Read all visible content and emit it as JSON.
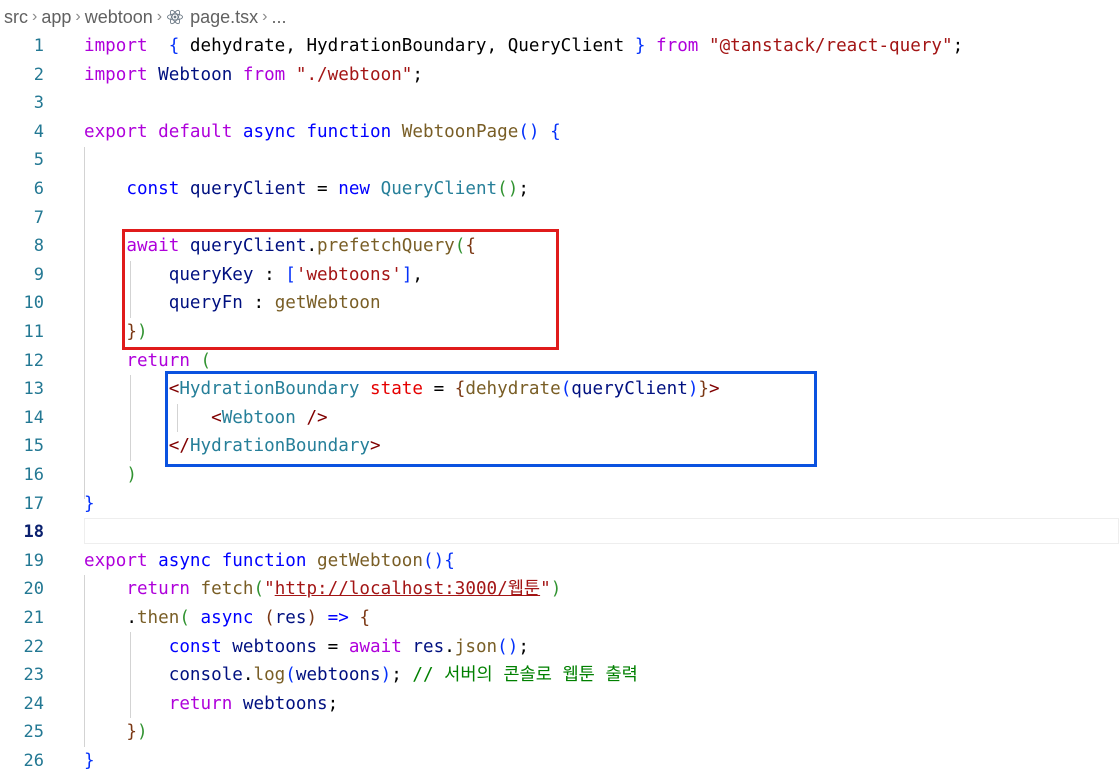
{
  "breadcrumb": {
    "items": [
      "src",
      "app",
      "webtoon",
      "page.tsx",
      "..."
    ],
    "file_icon": "react-icon",
    "separator_icon": "chevron-right-icon"
  },
  "editor": {
    "current_line": 18,
    "lines": [
      {
        "n": "1"
      },
      {
        "n": "2"
      },
      {
        "n": "3"
      },
      {
        "n": "4"
      },
      {
        "n": "5"
      },
      {
        "n": "6"
      },
      {
        "n": "7"
      },
      {
        "n": "8"
      },
      {
        "n": "9"
      },
      {
        "n": "10"
      },
      {
        "n": "11"
      },
      {
        "n": "12"
      },
      {
        "n": "13"
      },
      {
        "n": "14"
      },
      {
        "n": "15"
      },
      {
        "n": "16"
      },
      {
        "n": "17"
      },
      {
        "n": "18"
      },
      {
        "n": "19"
      },
      {
        "n": "20"
      },
      {
        "n": "21"
      },
      {
        "n": "22"
      },
      {
        "n": "23"
      },
      {
        "n": "24"
      },
      {
        "n": "25"
      },
      {
        "n": "26"
      }
    ],
    "tokens": [
      [
        [
          "t-kw",
          "import"
        ],
        [
          "",
          "  "
        ],
        [
          "t-p1",
          "{"
        ],
        [
          "",
          " dehydrate, HydrationBoundary, QueryClient "
        ],
        [
          "t-p1",
          "}"
        ],
        [
          "t-kw",
          " from "
        ],
        [
          "t-str",
          "\"@tanstack/react-query\""
        ],
        [
          "",
          ";"
        ]
      ],
      [
        [
          "t-kw",
          "import"
        ],
        [
          "t-var",
          " Webtoon"
        ],
        [
          "t-kw",
          " from "
        ],
        [
          "t-str",
          "\"./webtoon\""
        ],
        [
          "",
          ";"
        ]
      ],
      [],
      [
        [
          "t-kw",
          "export"
        ],
        [
          "t-kw",
          " default"
        ],
        [
          "t-ctl",
          " async"
        ],
        [
          "t-ctl",
          " function"
        ],
        [
          "t-fn",
          " WebtoonPage"
        ],
        [
          "t-p1",
          "()"
        ],
        [
          "",
          " "
        ],
        [
          "t-p1",
          "{"
        ]
      ],
      [],
      [
        [
          "",
          "    "
        ],
        [
          "t-ctl",
          "const"
        ],
        [
          "t-var",
          " queryClient"
        ],
        [
          "",
          " = "
        ],
        [
          "t-ctl",
          "new"
        ],
        [
          "t-cls",
          " QueryClient"
        ],
        [
          "t-p2",
          "()"
        ],
        [
          "",
          ";"
        ]
      ],
      [],
      [
        [
          "",
          "    "
        ],
        [
          "t-kw",
          "await"
        ],
        [
          "t-var",
          " queryClient"
        ],
        [
          "",
          "."
        ],
        [
          "t-fn",
          "prefetchQuery"
        ],
        [
          "t-p2",
          "("
        ],
        [
          "t-p3",
          "{"
        ]
      ],
      [
        [
          "",
          "        "
        ],
        [
          "t-var",
          "queryKey"
        ],
        [
          "",
          " : "
        ],
        [
          "t-p1b",
          "["
        ],
        [
          "t-str",
          "'webtoons'"
        ],
        [
          "t-p1b",
          "]"
        ],
        [
          "",
          ","
        ]
      ],
      [
        [
          "",
          "        "
        ],
        [
          "t-var",
          "queryFn"
        ],
        [
          "",
          " : "
        ],
        [
          "t-fn",
          "getWebtoon"
        ]
      ],
      [
        [
          "",
          "    "
        ],
        [
          "t-p3",
          "}"
        ],
        [
          "t-p2",
          ")"
        ]
      ],
      [
        [
          "",
          "    "
        ],
        [
          "t-kw",
          "return"
        ],
        [
          "",
          " "
        ],
        [
          "t-p2",
          "("
        ]
      ],
      [
        [
          "",
          "        "
        ],
        [
          "t-tag",
          "<"
        ],
        [
          "t-cls",
          "HydrationBoundary"
        ],
        [
          "t-attr",
          " state"
        ],
        [
          "",
          " = "
        ],
        [
          "t-p3",
          "{"
        ],
        [
          "t-fn",
          "dehydrate"
        ],
        [
          "t-p1b",
          "("
        ],
        [
          "t-var",
          "queryClient"
        ],
        [
          "t-p1b",
          ")"
        ],
        [
          "t-p3",
          "}"
        ],
        [
          "t-tag",
          ">"
        ]
      ],
      [
        [
          "",
          "            "
        ],
        [
          "t-tag",
          "<"
        ],
        [
          "t-cls",
          "Webtoon"
        ],
        [
          "t-tag",
          " />"
        ]
      ],
      [
        [
          "",
          "        "
        ],
        [
          "t-tag",
          "</"
        ],
        [
          "t-cls",
          "HydrationBoundary"
        ],
        [
          "t-tag",
          ">"
        ]
      ],
      [
        [
          "",
          "    "
        ],
        [
          "t-p2",
          ")"
        ]
      ],
      [
        [
          "t-p1",
          "}"
        ]
      ],
      [],
      [
        [
          "t-kw",
          "export"
        ],
        [
          "t-ctl",
          " async"
        ],
        [
          "t-ctl",
          " function"
        ],
        [
          "t-fn",
          " getWebtoon"
        ],
        [
          "t-p1",
          "()"
        ],
        [
          "t-p1",
          "{"
        ]
      ],
      [
        [
          "",
          "    "
        ],
        [
          "t-kw",
          "return"
        ],
        [
          "t-fn",
          " fetch"
        ],
        [
          "t-p2",
          "("
        ],
        [
          "t-str",
          "\""
        ],
        [
          "t-url",
          "http://localhost:3000/웹툰"
        ],
        [
          "t-str",
          "\""
        ],
        [
          "t-p2",
          ")"
        ]
      ],
      [
        [
          "",
          "    ."
        ],
        [
          "t-fn",
          "then"
        ],
        [
          "t-p2",
          "("
        ],
        [
          "",
          " "
        ],
        [
          "t-ctl",
          "async"
        ],
        [
          "",
          " "
        ],
        [
          "t-p3",
          "("
        ],
        [
          "t-var",
          "res"
        ],
        [
          "t-p3",
          ")"
        ],
        [
          "t-ctl",
          " =>"
        ],
        [
          "",
          " "
        ],
        [
          "t-p3",
          "{"
        ]
      ],
      [
        [
          "",
          "        "
        ],
        [
          "t-ctl",
          "const"
        ],
        [
          "t-var",
          " webtoons"
        ],
        [
          "",
          " = "
        ],
        [
          "t-kw",
          "await"
        ],
        [
          "t-var",
          " res"
        ],
        [
          "",
          "."
        ],
        [
          "t-fn",
          "json"
        ],
        [
          "t-p1b",
          "()"
        ],
        [
          "",
          ";"
        ]
      ],
      [
        [
          "",
          "        "
        ],
        [
          "t-var",
          "console"
        ],
        [
          "",
          "."
        ],
        [
          "t-fn",
          "log"
        ],
        [
          "t-p1b",
          "("
        ],
        [
          "t-var",
          "webtoons"
        ],
        [
          "t-p1b",
          ")"
        ],
        [
          "",
          ";"
        ],
        [
          "t-com",
          " // 서버의 콘솔로 웹툰 출력"
        ]
      ],
      [
        [
          "",
          "        "
        ],
        [
          "t-kw",
          "return"
        ],
        [
          "t-var",
          " webtoons"
        ],
        [
          "",
          ";"
        ]
      ],
      [
        [
          "",
          "    "
        ],
        [
          "t-p3",
          "}"
        ],
        [
          "t-p2",
          ")"
        ]
      ],
      [
        [
          "t-p1",
          "}"
        ]
      ]
    ]
  },
  "colors": {
    "red_box": "#e01b1b",
    "blue_box": "#0a52e0",
    "line_number": "#237893",
    "keyword": "#af00db",
    "storage": "#0000ff",
    "string": "#a31515",
    "comment": "#008000"
  }
}
